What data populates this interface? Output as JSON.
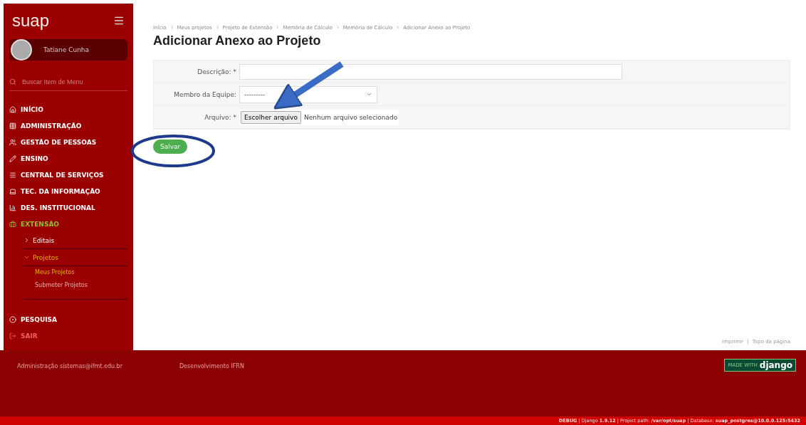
{
  "sidebar": {
    "logo": "suap",
    "user": {
      "name": "Tatiane Cunha"
    },
    "search": {
      "placeholder": "Buscar Item de Menu"
    },
    "items": [
      {
        "label": "INÍCIO",
        "kind": "link",
        "selected": false
      },
      {
        "label": "ADMINISTRAÇÃO",
        "kind": "link",
        "selected": false
      },
      {
        "label": "GESTÃO DE PESSOAS",
        "kind": "link",
        "selected": false
      },
      {
        "label": "ENSINO",
        "kind": "link",
        "selected": false
      },
      {
        "label": "CENTRAL DE SERVIÇOS",
        "kind": "link",
        "selected": false
      },
      {
        "label": "TEC. DA INFORMAÇÃO",
        "kind": "link",
        "selected": false
      },
      {
        "label": "DES. INSTITUCIONAL",
        "kind": "link",
        "selected": false
      },
      {
        "label": "EXTENSÃO",
        "kind": "link",
        "selected": true,
        "children": [
          {
            "label": "Editais",
            "expanded": false
          },
          {
            "label": "Projetos",
            "expanded": true,
            "children": [
              {
                "label": "Meus Projetos",
                "selected": true
              },
              {
                "label": "Submeter Projetos",
                "selected": false
              }
            ]
          }
        ]
      },
      {
        "label": "PESQUISA",
        "kind": "link",
        "selected": false
      },
      {
        "label": "SAIR",
        "kind": "logout"
      }
    ]
  },
  "breadcrumbs": [
    "Início",
    "Meus projetos",
    "Projeto de Extensão",
    "Memória de Cálculo",
    "Memória de Cálculo",
    "Adicionar Anexo ao Projeto"
  ],
  "title": "Adicionar Anexo ao Projeto",
  "form": {
    "fields": [
      {
        "label": "Descrição: *",
        "kind": "text"
      },
      {
        "label": "Membro da Equipe:",
        "kind": "select",
        "value": "---------"
      },
      {
        "label": "Arquivo: *",
        "kind": "file",
        "button": "Escolher arquivo",
        "value": "Nenhum arquivo selecionado"
      }
    ],
    "submit": "Salvar"
  },
  "page_links": [
    "Imprimir",
    "Topo da página"
  ],
  "footer": {
    "items": [
      {
        "label": "Administração",
        "value": "sistemas@ifmt.edu.br"
      },
      {
        "label": "Desenvolvimento",
        "value": "IFRN"
      }
    ],
    "badge": {
      "small": "MADE WITH",
      "big": "django"
    }
  },
  "debug_bar": "**DEBUG** | Django **1.9.12** | Project path: **/var/opt/suap** | Database: **suap_postgres@10.0.0.125:5432**"
}
